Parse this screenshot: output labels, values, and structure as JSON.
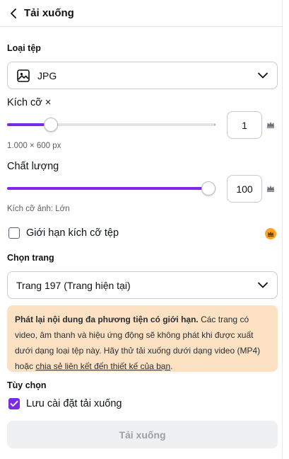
{
  "header": {
    "title": "Tải xuống"
  },
  "file_type": {
    "label": "Loại tệp",
    "value": "JPG"
  },
  "size": {
    "label": "Kích cỡ ×",
    "value": "1",
    "dimensions": "1.000 × 600 px",
    "slider_fraction": 0.21
  },
  "quality": {
    "label": "Chất lượng",
    "value": "100",
    "caption": "Kích cỡ ảnh: Lớn",
    "slider_fraction": 1.0
  },
  "limit_size": {
    "label": "Giới hạn kích cỡ tệp",
    "checked": false
  },
  "page_select": {
    "label": "Chọn trang",
    "value": "Trang 197 (Trang hiện tại)"
  },
  "notice": {
    "bold": "Phát lại nội dung đa phương tiện có giới hạn.",
    "text": " Các trang có video, âm thanh và hiệu ứng động sẽ không phát khi được xuất dưới dạng loại tệp này. Hãy thử tải xuống dưới dạng video (MP4) hoặc ",
    "link": "chia sẻ liên kết đến thiết kế của bạn",
    "end": "."
  },
  "options": {
    "label": "Tùy chọn",
    "save_settings_label": "Lưu cài đặt tải xuống",
    "save_settings_checked": true
  },
  "download_button": {
    "label": "Tải xuống"
  },
  "colors": {
    "accent": "#7d2ae8",
    "notice_bg": "#fde1c3",
    "crown": "#f5a623"
  }
}
